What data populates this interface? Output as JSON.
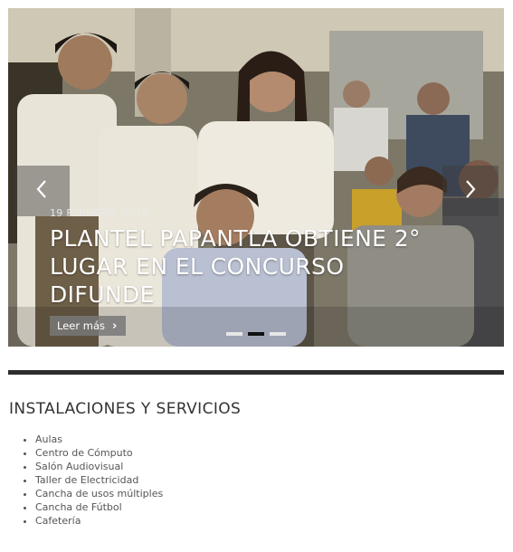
{
  "slider": {
    "date": "19 FEBRERO, 2018",
    "title": "PLANTEL PAPANTLA OBTIENE 2° LUGAR EN EL CONCURSO DIFUNDE",
    "read_more": "Leer más",
    "prev_icon": "chevron-left-icon",
    "next_icon": "chevron-right-icon",
    "read_more_icon": "chevron-right-icon",
    "slide_count": 3,
    "active_slide": 2
  },
  "section": {
    "title": "INSTALACIONES Y SERVICIOS",
    "items": [
      "Aulas",
      "Centro de Cómputo",
      "Salón Audiovisual",
      "Taller de Electricidad",
      "Cancha de usos múltiples",
      "Cancha de Fútbol",
      "Cafetería"
    ]
  },
  "colors": {
    "divider": "#2d2d2d",
    "dot_active": "#111111",
    "dot_inactive": "#e6e6e6",
    "text": "#333333"
  }
}
